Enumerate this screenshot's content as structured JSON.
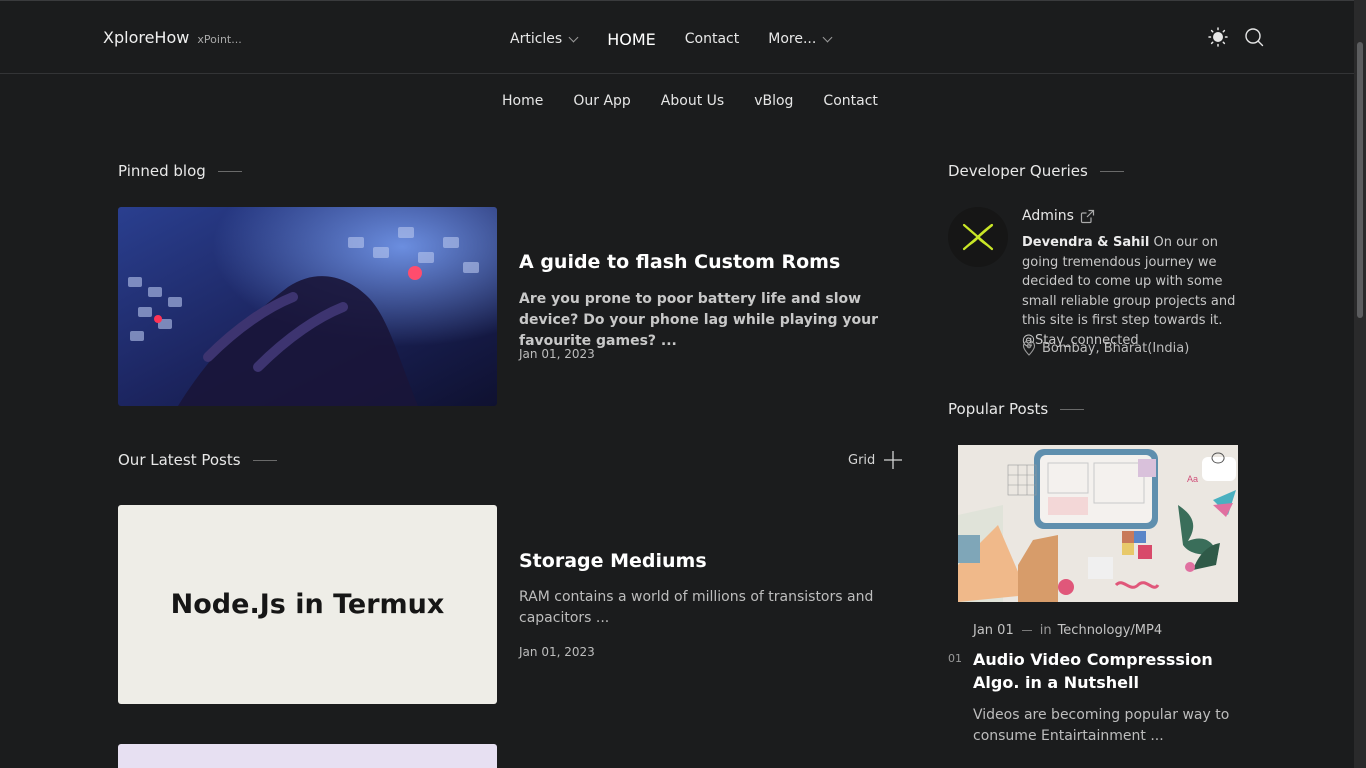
{
  "brand": {
    "name": "XploreHow",
    "tagline": "xPoint..."
  },
  "main_nav": {
    "articles": "Articles",
    "home": "HOME",
    "contact": "Contact",
    "more": "More..."
  },
  "sub_nav": [
    "Home",
    "Our App",
    "About Us",
    "vBlog",
    "Contact"
  ],
  "pinned": {
    "heading": "Pinned blog",
    "title": "A guide to flash Custom Roms",
    "excerpt": "Are you prone to poor battery life and slow device? Do your phone lag while playing your favourite games? ...",
    "date": "Jan 01, 2023"
  },
  "latest": {
    "heading": "Our Latest Posts",
    "grid_label": "Grid",
    "posts": [
      {
        "thumb_text": "Node.Js in Termux",
        "title": "Storage Mediums",
        "excerpt": "RAM contains a world of millions of transistors and capacitors ...",
        "date": "Jan 01, 2023"
      }
    ]
  },
  "developer": {
    "heading": "Developer Queries",
    "admin_label": "Admins",
    "authors": "Devendra & Sahil",
    "bio": " On our on going tremendous journey we decided to come up with some small reliable group projects and this site is first step towards it. @Stay_connected",
    "location": "Bombay, Bharat(India)"
  },
  "popular": {
    "heading": "Popular Posts",
    "posts": [
      {
        "number": "01",
        "date": "Jan 01",
        "in_label": "in",
        "category": "Technology/MP4",
        "title": "Audio Video Compresssion Algo. in a Nutshell",
        "excerpt": "Videos are becoming popular way to consume Entairtainment ..."
      }
    ]
  },
  "icons": {
    "theme": "sun-icon",
    "search": "search-icon",
    "grid_toggle": "plus-icon",
    "external": "external-link-icon",
    "location": "map-pin-icon",
    "comment": "comment-icon"
  },
  "colors": {
    "background": "#1b1c1d",
    "text": "#e4e4e4",
    "accent": "#c9e627"
  }
}
